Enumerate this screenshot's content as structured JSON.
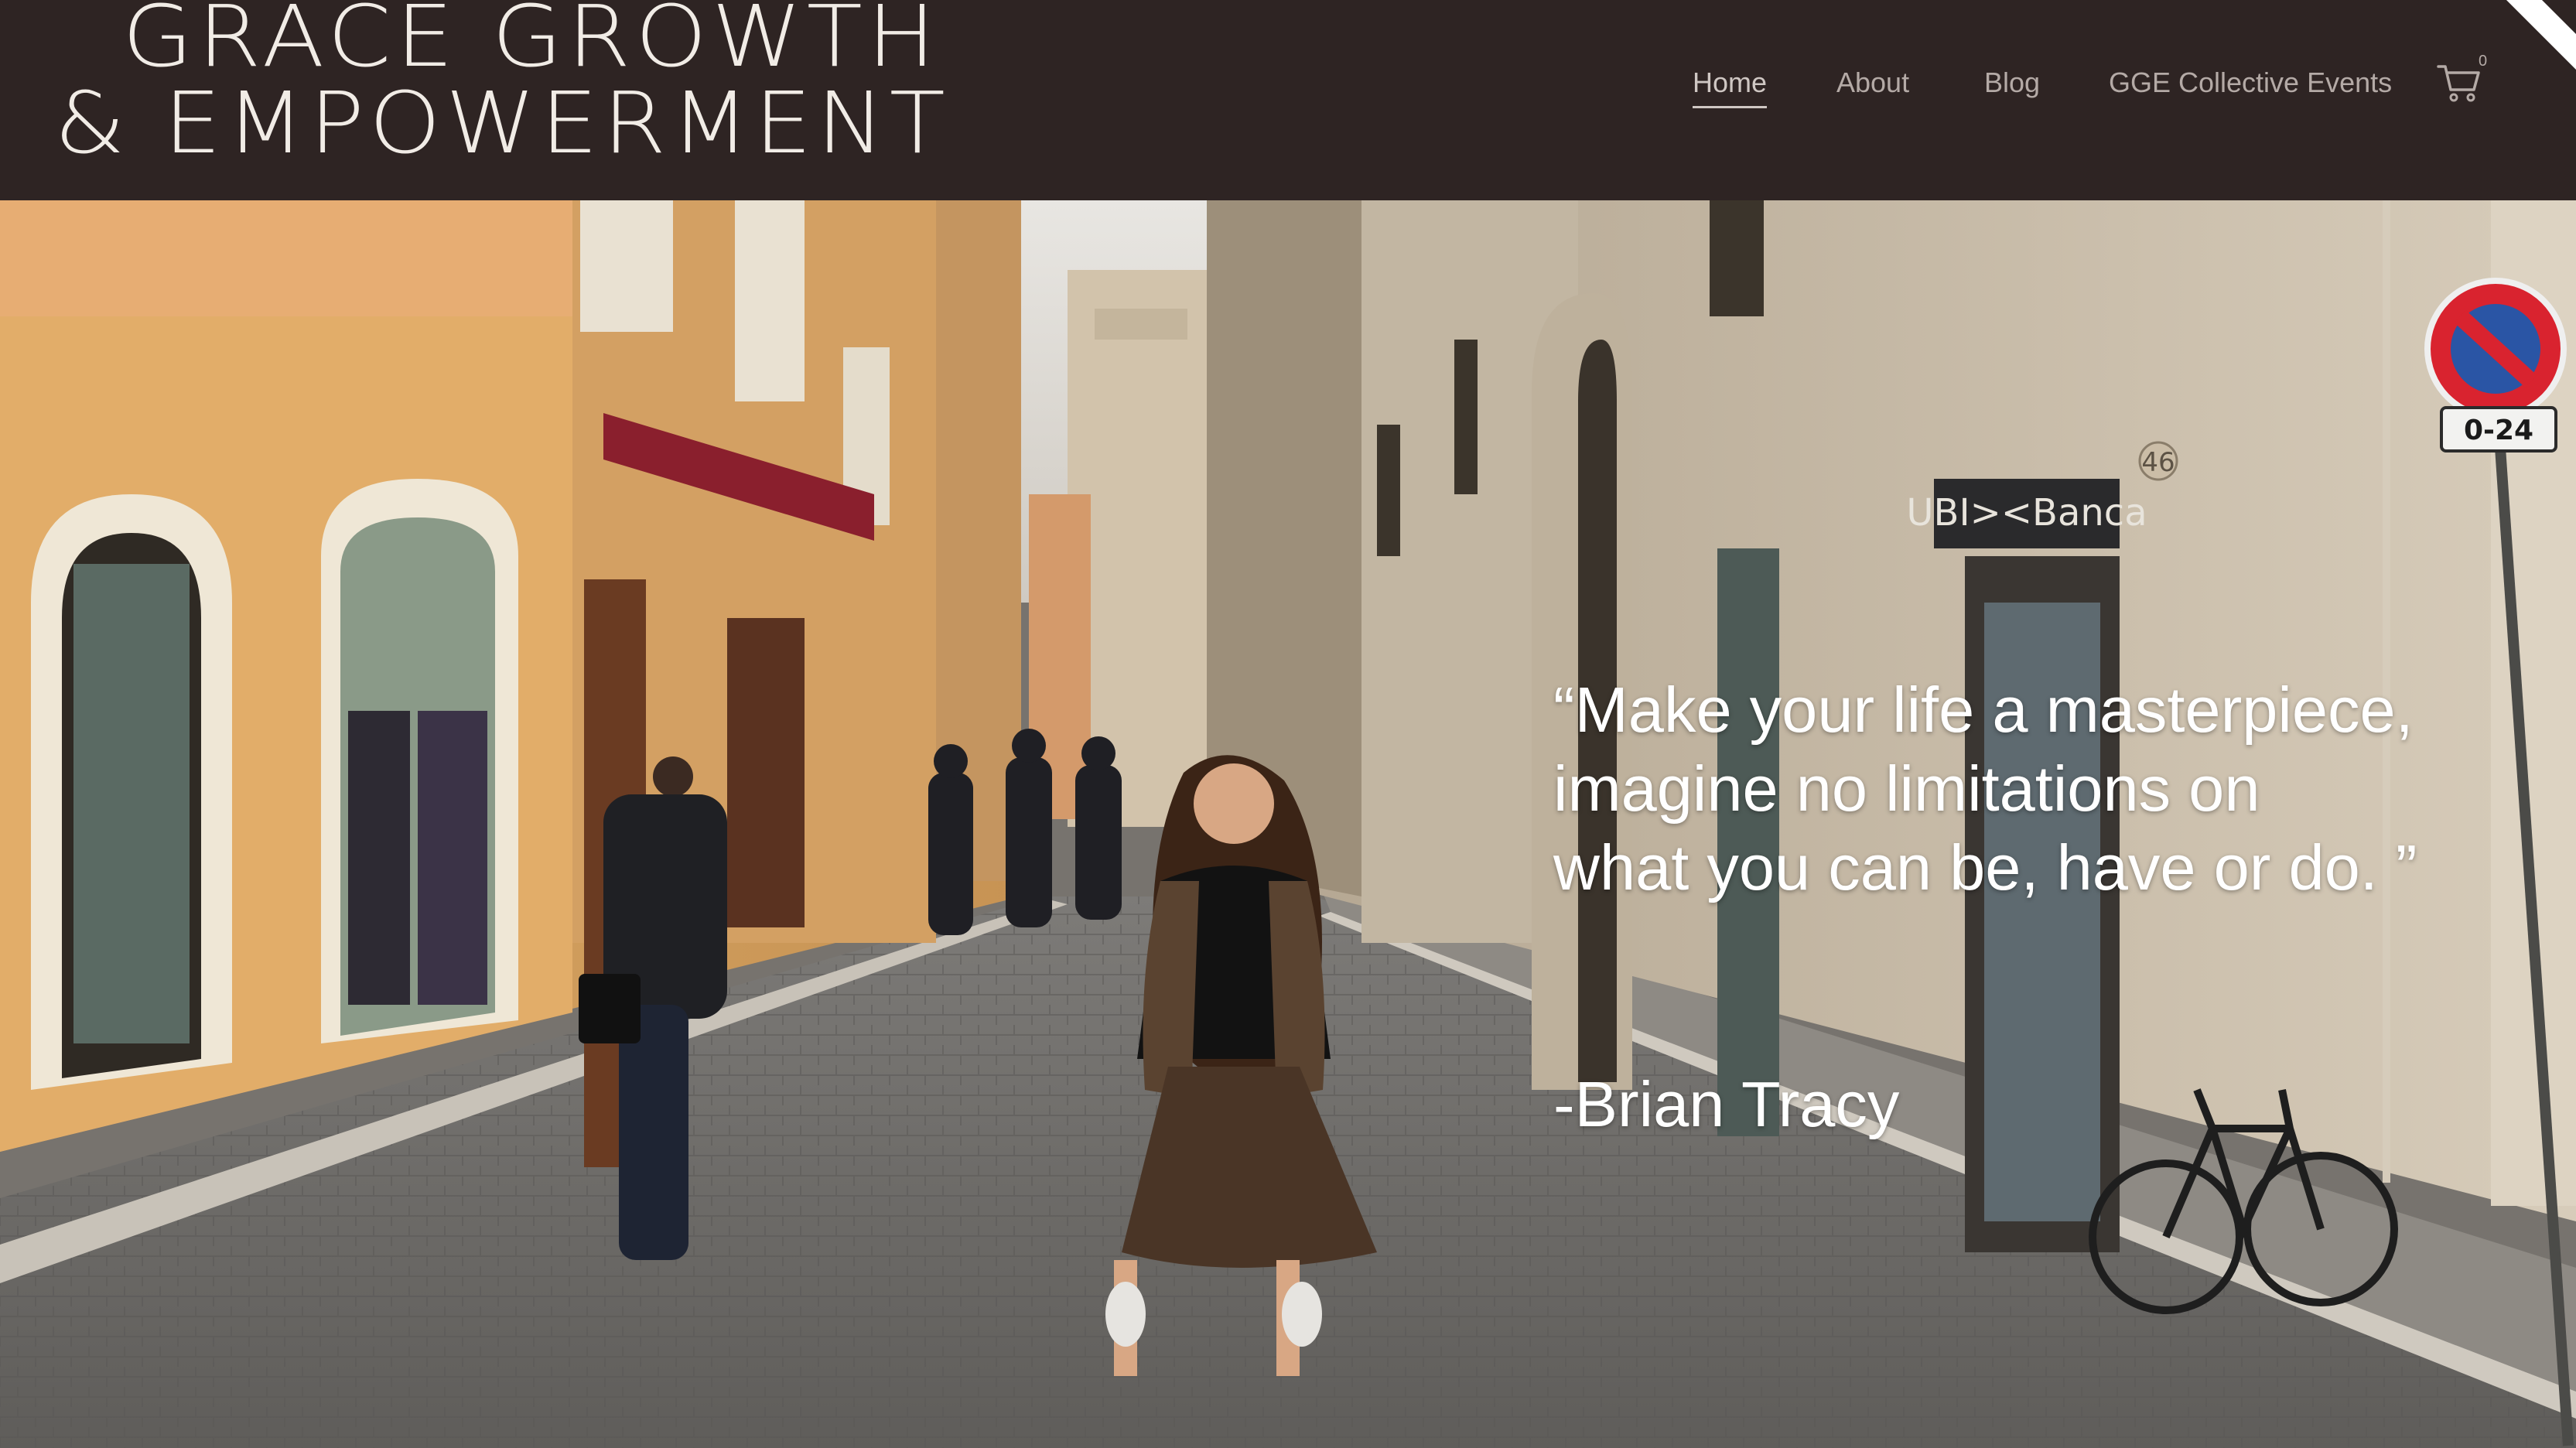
{
  "brand": {
    "line1": "GRACE GROWTH",
    "line2": "& EMPOWERMENT"
  },
  "nav": {
    "items": [
      {
        "label": "Home",
        "active": true
      },
      {
        "label": "About",
        "active": false
      },
      {
        "label": "Blog",
        "active": false
      },
      {
        "label": "GGE Collective Events",
        "active": false
      }
    ],
    "cart_icon": "cart-icon",
    "cart_count": "0"
  },
  "hero": {
    "quote_lines": [
      "“Make your life a masterpiece,",
      "imagine no limitations on",
      "what you can be, have or do. ”"
    ],
    "author": "-Brian Tracy",
    "sign_text": "0-24",
    "bank_sign": "UBI><Banca",
    "address_number": "46"
  },
  "colors": {
    "header_bg": "#2e2423",
    "logo_text": "#f1ece6",
    "nav_text": "#b4aaa6",
    "quote_text": "#ffffff"
  }
}
